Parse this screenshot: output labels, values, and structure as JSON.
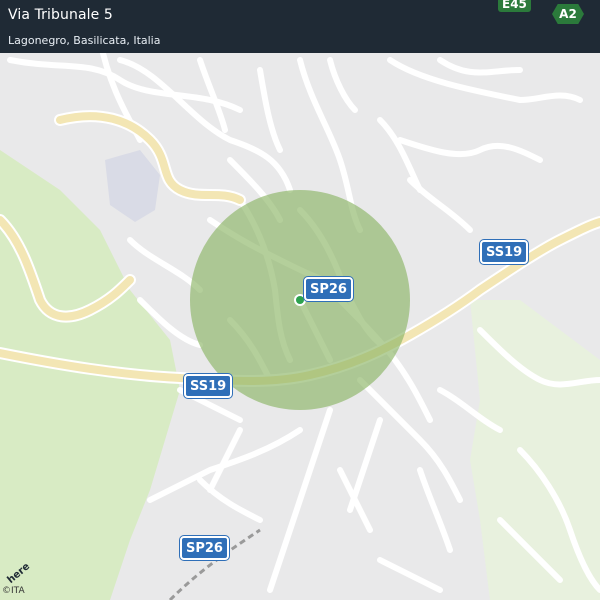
{
  "header": {
    "title": "Via Tribunale 5",
    "subtitle": "Lagonegro, Basilicata, Italia"
  },
  "shields": {
    "sp26_center": "SP26",
    "ss19_east": "SS19",
    "ss19_west": "SS19",
    "sp26_south": "SP26"
  },
  "highways": {
    "e45": "E45",
    "a2": "A2"
  },
  "branding": {
    "logo": "here",
    "copyright": "©ITA"
  },
  "colors": {
    "header_bg": "#1f2a35",
    "radius_fill": "#8cb566",
    "shield_blue": "#2f6fb8",
    "main_road": "#f3e6b4",
    "green_area": "#d8ebc4",
    "location_marker": "#2ea24f"
  }
}
